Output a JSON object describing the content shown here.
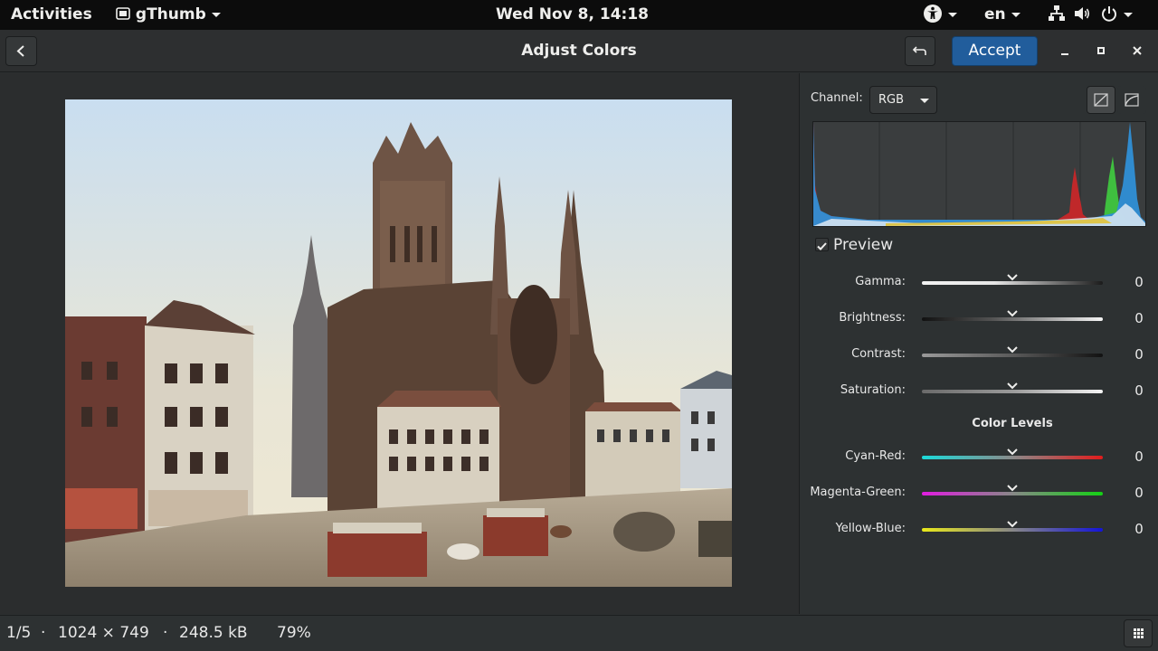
{
  "topbar": {
    "activities": "Activities",
    "app_name": "gThumb",
    "clock": "Wed Nov  8, 14:18",
    "lang": "en"
  },
  "header": {
    "title": "Adjust Colors",
    "accept_label": "Accept"
  },
  "sidebar": {
    "channel_label": "Channel:",
    "channel_value": "RGB",
    "preview_label": "Preview",
    "preview_checked": true,
    "sliders": [
      {
        "label": "Gamma:",
        "value": "0"
      },
      {
        "label": "Brightness:",
        "value": "0"
      },
      {
        "label": "Contrast:",
        "value": "0"
      },
      {
        "label": "Saturation:",
        "value": "0"
      }
    ],
    "color_levels_title": "Color Levels",
    "levels": [
      {
        "label": "Cyan-Red:",
        "value": "0"
      },
      {
        "label": "Magenta-Green:",
        "value": "0"
      },
      {
        "label": "Yellow-Blue:",
        "value": "0"
      }
    ]
  },
  "statusbar": {
    "position": "1/5",
    "sep1": "·",
    "dimensions": "1024 × 749",
    "sep2": "·",
    "filesize": "248.5 kB",
    "zoom": "79%"
  },
  "colors": {
    "accent": "#215d9c",
    "histogram_red": "#c0282a",
    "histogram_green": "#3fbf3f",
    "histogram_blue": "#2f8fd6"
  }
}
